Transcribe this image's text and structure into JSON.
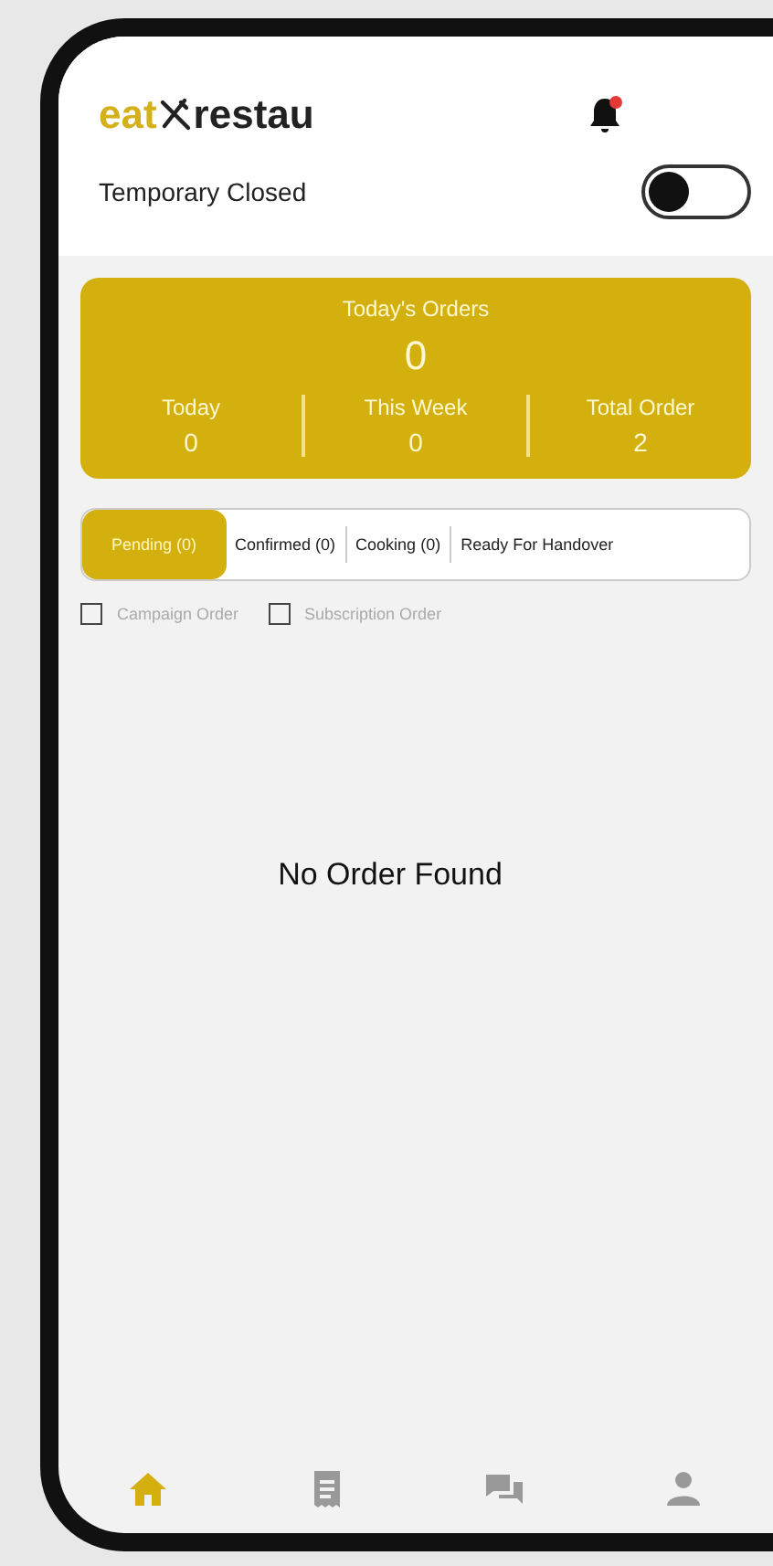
{
  "header": {
    "logo_first": "eat",
    "logo_second": "restau",
    "notification_dot": true
  },
  "temporary_closed": {
    "label": "Temporary Closed",
    "on": false
  },
  "summary": {
    "title": "Today's Orders",
    "count": "0",
    "stats": [
      {
        "label": "Today",
        "value": "0"
      },
      {
        "label": "This Week",
        "value": "0"
      },
      {
        "label": "Total Order",
        "value": "2"
      }
    ]
  },
  "tabs": [
    {
      "label": "Pending (0)",
      "selected": true
    },
    {
      "label": "Confirmed (0)",
      "selected": false
    },
    {
      "label": "Cooking (0)",
      "selected": false
    },
    {
      "label": "Ready For Handover",
      "selected": false
    }
  ],
  "filters": [
    {
      "label": "Campaign Order",
      "checked": false
    },
    {
      "label": "Subscription Order",
      "checked": false
    }
  ],
  "empty_message": "No Order Found",
  "bottom_nav": [
    {
      "kind": "home",
      "selected": true
    },
    {
      "kind": "orders",
      "selected": false
    },
    {
      "kind": "chat",
      "selected": false
    },
    {
      "kind": "profile",
      "selected": false
    }
  ]
}
